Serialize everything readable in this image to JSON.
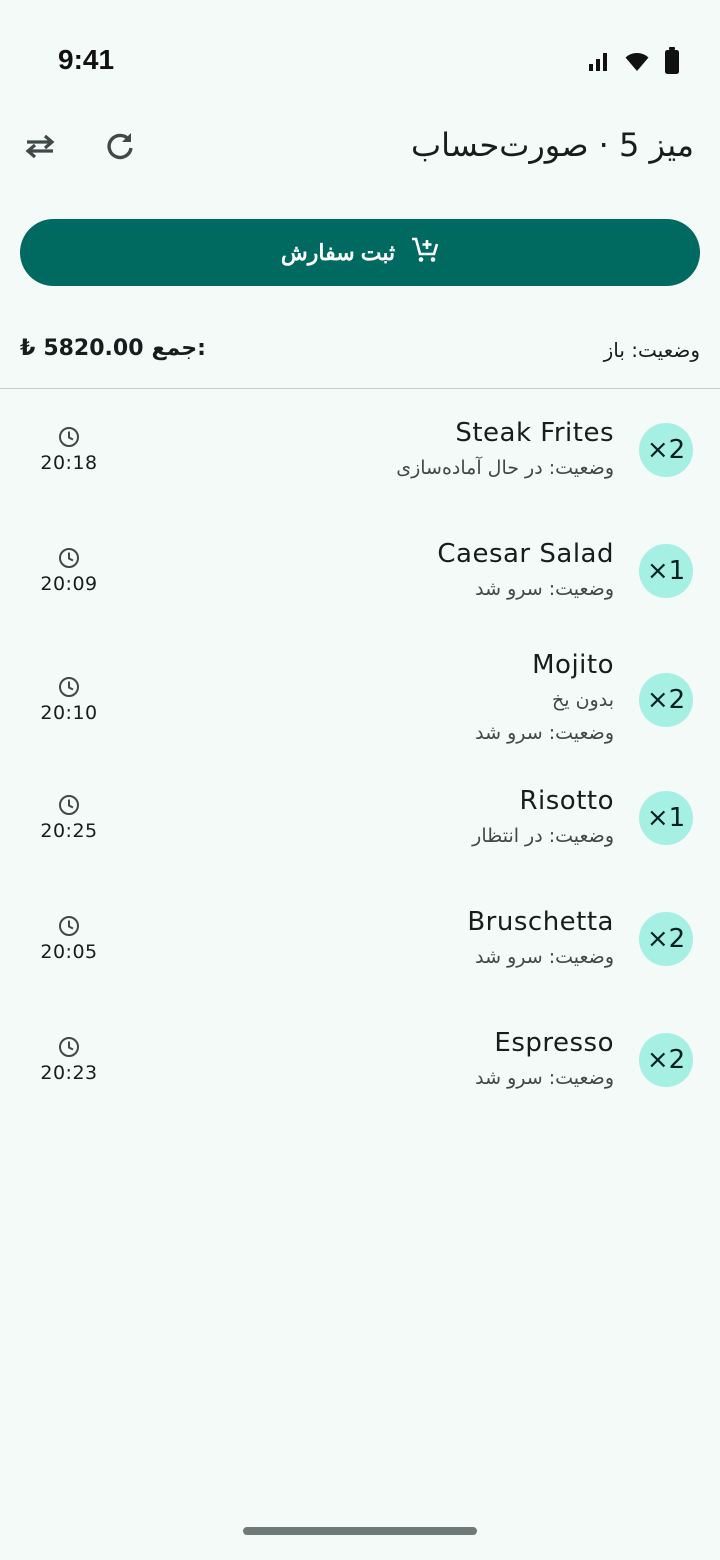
{
  "status_bar": {
    "time": "9:41",
    "icons": [
      "cellular-signal-icon",
      "wifi-icon",
      "battery-icon"
    ]
  },
  "app_bar": {
    "title": "میز 5 · صورت‌حساب",
    "actions": [
      "refresh-icon",
      "swap-icon"
    ]
  },
  "submit_button": {
    "label": "ثبت سفارش",
    "icon": "add-to-cart-icon"
  },
  "summary": {
    "status": "وضعیت: باز",
    "total_label": "جمع:",
    "total_value": "5820.00",
    "currency_symbol": "₺"
  },
  "colors": {
    "primary": "#006a61",
    "badge": "#a6efe3",
    "background": "#f3faf8"
  },
  "items": [
    {
      "qty": "×2",
      "name": "Steak Frites",
      "note": "",
      "status": "وضعیت: در حال آماده‌سازی",
      "time": "20:18"
    },
    {
      "qty": "×1",
      "name": "Caesar Salad",
      "note": "",
      "status": "وضعیت: سرو شد",
      "time": "20:09"
    },
    {
      "qty": "×2",
      "name": "Mojito",
      "note": "بدون یخ",
      "status": "وضعیت: سرو شد",
      "time": "20:10"
    },
    {
      "qty": "×1",
      "name": "Risotto",
      "note": "",
      "status": "وضعیت: در انتظار",
      "time": "20:25"
    },
    {
      "qty": "×2",
      "name": "Bruschetta",
      "note": "",
      "status": "وضعیت: سرو شد",
      "time": "20:05"
    },
    {
      "qty": "×2",
      "name": "Espresso",
      "note": "",
      "status": "وضعیت: سرو شد",
      "time": "20:23"
    }
  ]
}
